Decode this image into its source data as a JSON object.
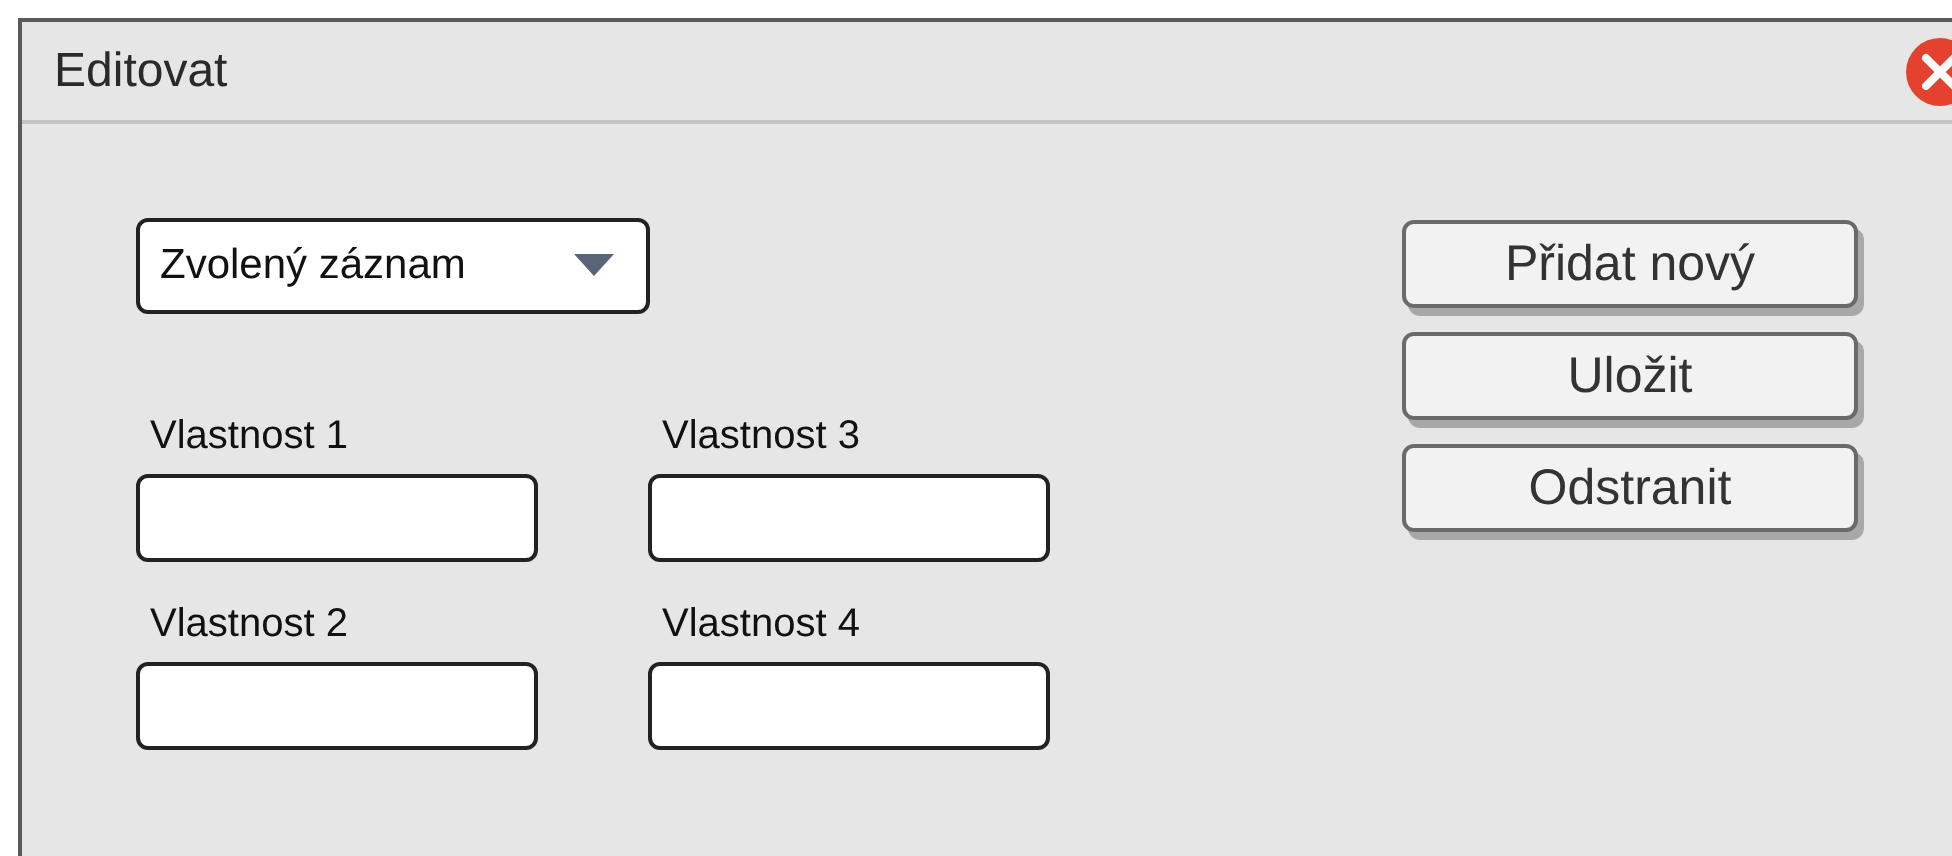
{
  "window": {
    "title": "Editovat"
  },
  "record_select": {
    "value": "Zvolený záznam"
  },
  "fields": [
    {
      "label": "Vlastnost 1"
    },
    {
      "label": "Vlastnost 3"
    },
    {
      "label": "Vlastnost 2"
    },
    {
      "label": "Vlastnost 4"
    }
  ],
  "buttons": [
    "Přidat nový",
    "Uložit",
    "Odstranit"
  ]
}
